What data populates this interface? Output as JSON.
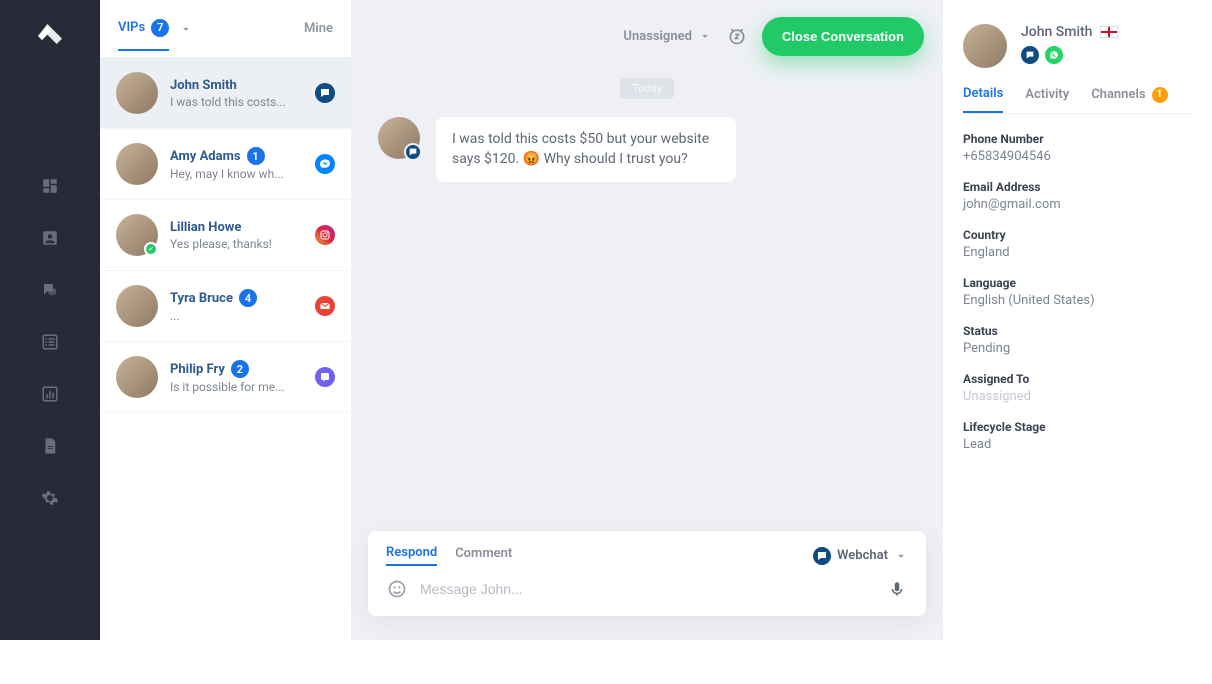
{
  "tabs": {
    "vips": "VIPs",
    "vips_count": "7",
    "mine": "Mine"
  },
  "conversations": [
    {
      "name": "John Smith",
      "snippet": "I was told this costs...",
      "channel": "webchat",
      "selected": true
    },
    {
      "name": "Amy Adams",
      "snippet": "Hey, may I know wh...",
      "badge": "1",
      "channel": "messenger"
    },
    {
      "name": "Lillian Howe",
      "snippet": "Yes please, thanks!",
      "channel": "instagram",
      "online": true
    },
    {
      "name": "Tyra Bruce",
      "snippet": "...",
      "badge": "4",
      "channel": "gmail"
    },
    {
      "name": "Philip Fry",
      "snippet": "Is it possible for me...",
      "badge": "2",
      "channel": "viber"
    }
  ],
  "chat": {
    "assignee": "Unassigned",
    "close_label": "Close Conversation",
    "day": "Today",
    "message": "I was told this costs $50 but your website says $120. 😡 Why should I trust you?"
  },
  "composer": {
    "respond": "Respond",
    "comment": "Comment",
    "channel": "Webchat",
    "placeholder": "Message John..."
  },
  "details": {
    "name": "John Smith",
    "tabs": {
      "details": "Details",
      "activity": "Activity",
      "channels": "Channels",
      "channels_badge": "1"
    },
    "fields": {
      "phone_label": "Phone Number",
      "phone": "+65834904546",
      "email_label": "Email Address",
      "email": "john@gmail.com",
      "country_label": "Country",
      "country": "England",
      "language_label": "Language",
      "language": "English (United States)",
      "status_label": "Status",
      "status": "Pending",
      "assigned_label": "Assigned To",
      "assigned": "Unassigned",
      "lifecycle_label": "Lifecycle Stage",
      "lifecycle": "Lead"
    }
  }
}
